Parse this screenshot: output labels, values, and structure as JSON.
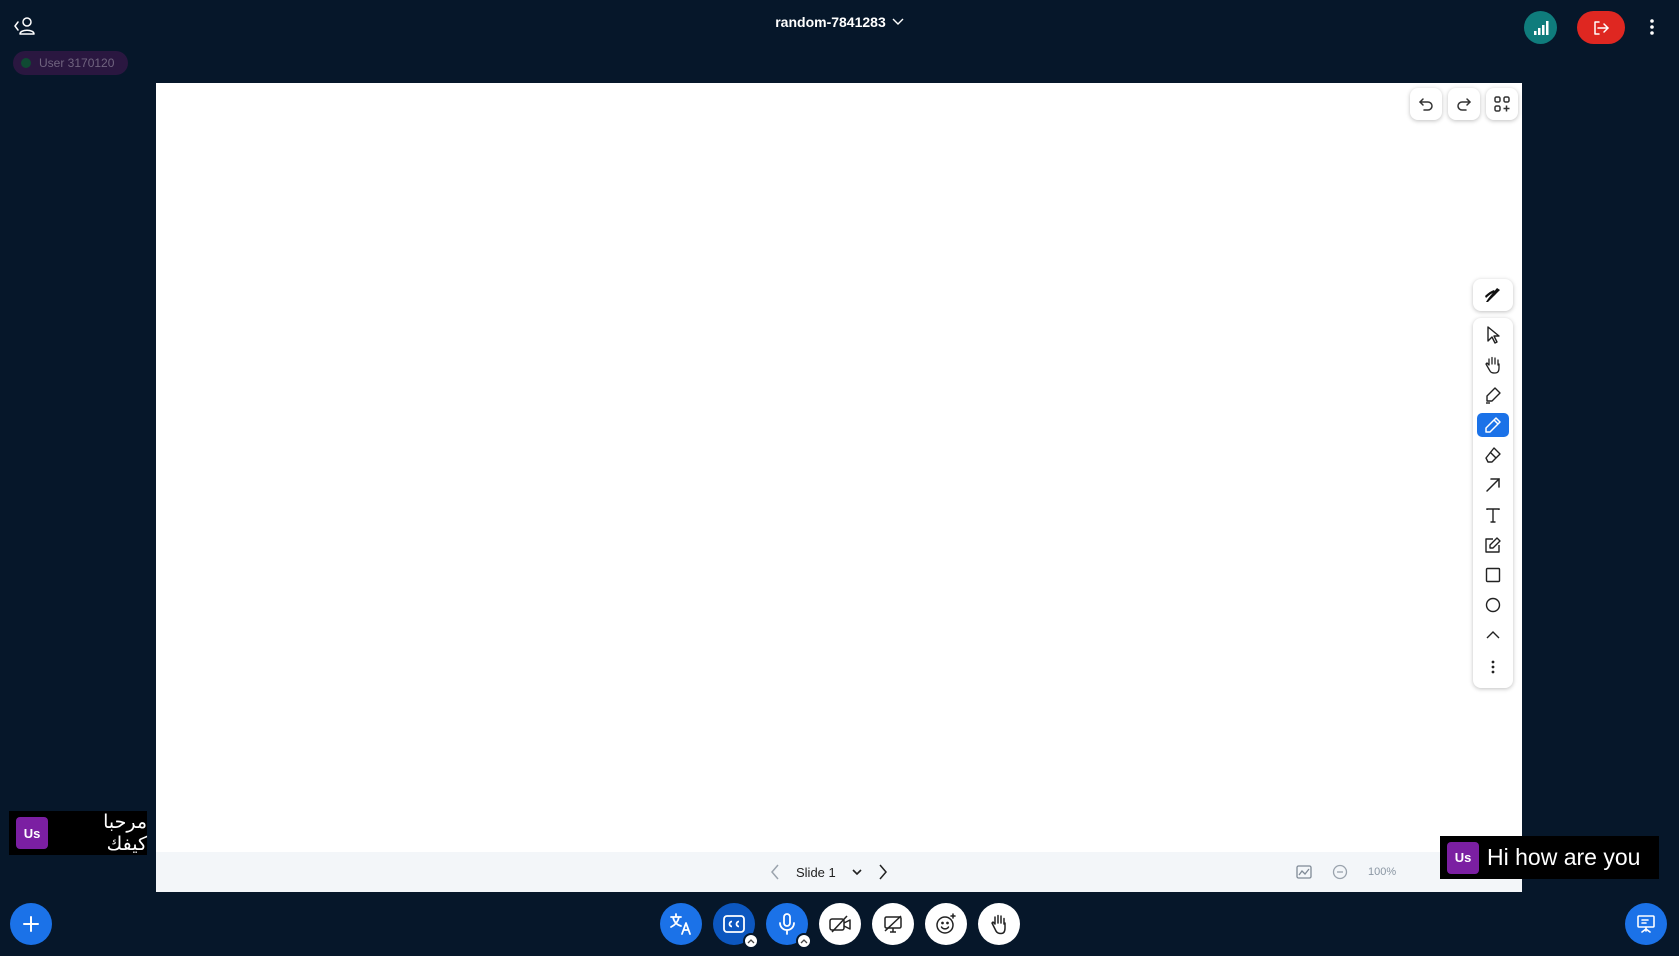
{
  "header": {
    "meeting_title": "random-7841283",
    "icons": {
      "user_list": "user-list-toggle-icon",
      "connection": "signal-bars-icon",
      "leave": "leave-session-icon",
      "more": "vertical-dots-icon"
    },
    "colors": {
      "connection": "#0f7c7c",
      "leave": "#df2721",
      "background": "#06172a"
    }
  },
  "talking_indicator": {
    "user_name": "User 3170120"
  },
  "whiteboard": {
    "undo_icon": "undo-icon",
    "redo_icon": "redo-icon",
    "toolbar_toggle_icon": "grid-plus-icon",
    "style_icon": "brush-style-icon",
    "active_tool": "draw",
    "tools": [
      "select",
      "hand",
      "highlighter",
      "draw",
      "eraser",
      "arrow",
      "text",
      "note",
      "rectangle",
      "ellipse",
      "chevron-up",
      "more"
    ],
    "active_color": "#1b72e8"
  },
  "slide_nav": {
    "current_slide_label": "Slide 1",
    "zoom": "100%"
  },
  "captions": {
    "left": {
      "avatar": "Us",
      "text": "مرحبا كيفك"
    },
    "right": {
      "avatar": "Us",
      "text": "Hi how are you"
    },
    "avatar_color": "#7b1fa2"
  },
  "bottom_bar": {
    "actions": [
      "translate",
      "closed-captions",
      "microphone",
      "camera-off",
      "screenshare-off",
      "reactions",
      "raise-hand"
    ],
    "accent": "#1b72e8"
  }
}
